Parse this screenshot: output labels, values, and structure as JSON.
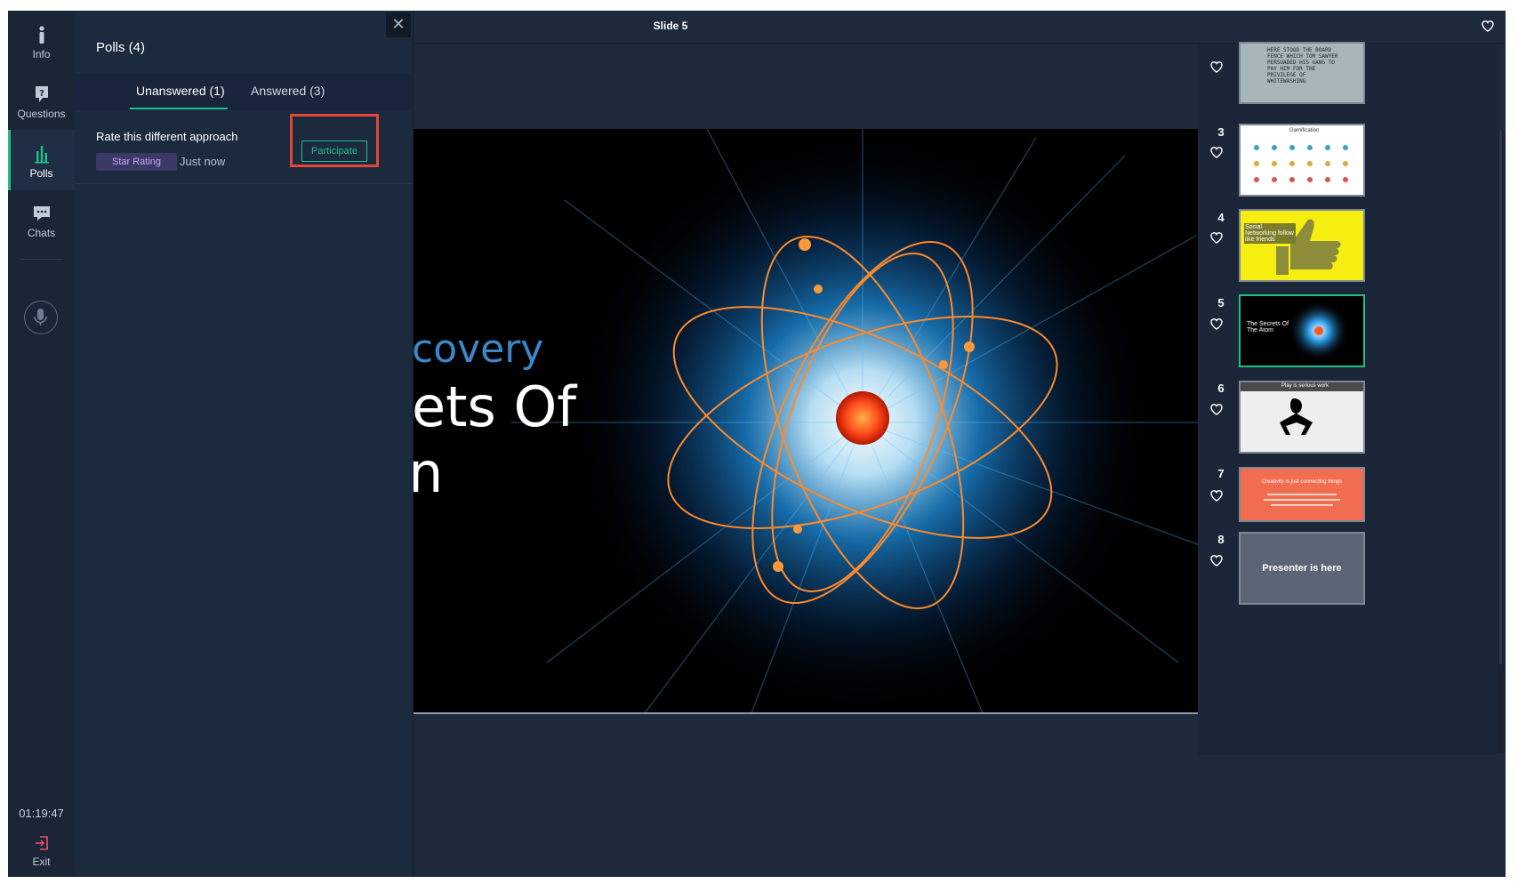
{
  "rail": {
    "items": [
      {
        "label": "Info",
        "icon": "info-icon"
      },
      {
        "label": "Questions",
        "icon": "question-bubble-icon"
      },
      {
        "label": "Polls",
        "icon": "bar-chart-icon"
      },
      {
        "label": "Chats",
        "icon": "chat-bubble-icon"
      }
    ],
    "active": "Polls",
    "timer": "01:19:47",
    "exit_label": "Exit"
  },
  "polls": {
    "title": "Polls (4)",
    "close_icon": "close-icon",
    "tabs": [
      "Unanswered (1)",
      "Answered (3)"
    ],
    "active_tab": "Unanswered (1)",
    "items": [
      {
        "question": "Rate this different approach",
        "type": "Star Rating",
        "time": "Just now",
        "action": "Participate"
      }
    ]
  },
  "header": {
    "title": "Slide 5"
  },
  "slide": {
    "line1": "covery",
    "line2": "ets Of",
    "line3": "n"
  },
  "thumbnails": [
    {
      "number": "",
      "text": "HERE STOOD THE BOARD FENCE WHICH TOM SAWYER PERSUADED HIS GANG TO PAY HIM FOR THE PRIVILEGE OF WHITEWASHING"
    },
    {
      "number": "3",
      "text": "Gamification"
    },
    {
      "number": "4",
      "text": "Social Networking  follow like friends"
    },
    {
      "number": "5",
      "text": "The Secrets Of The Atom"
    },
    {
      "number": "6",
      "text": "Play is serious work"
    },
    {
      "number": "7",
      "text": "Creativity is just connecting things"
    },
    {
      "number": "8",
      "text": "Presenter is here"
    }
  ],
  "colors": {
    "accent": "#1dbf8a",
    "highlight": "#e1473a",
    "background": "#1e2a3c"
  }
}
